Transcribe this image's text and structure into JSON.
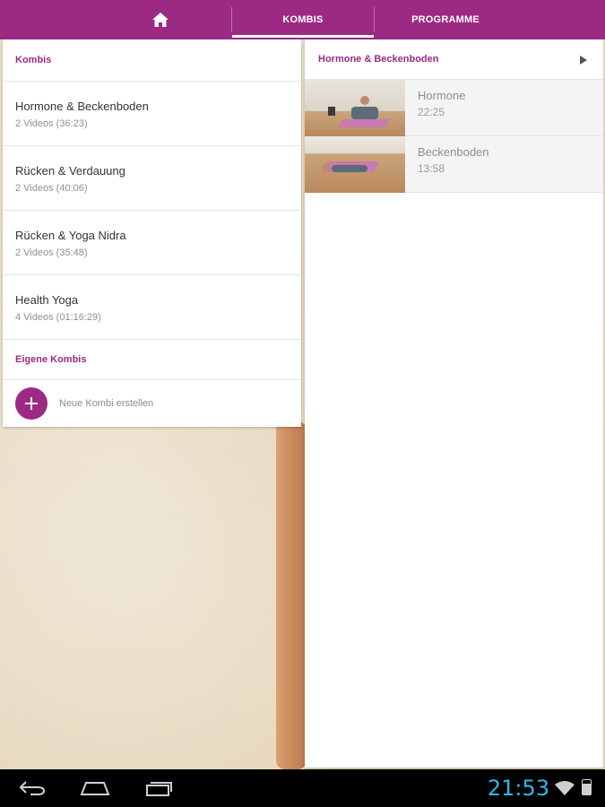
{
  "topbar": {
    "tabs": [
      {
        "label": "",
        "icon": "home-icon"
      },
      {
        "label": "KOMBIS",
        "selected": true
      },
      {
        "label": "PROGRAMME"
      }
    ]
  },
  "left": {
    "header": "Kombis",
    "items": [
      {
        "title": "Hormone & Beckenboden",
        "sub": "2 Videos (36:23)"
      },
      {
        "title": "Rücken & Verdauung",
        "sub": "2 Videos (40:06)"
      },
      {
        "title": "Rücken & Yoga Nidra",
        "sub": "2 Videos (35:48)"
      },
      {
        "title": "Health Yoga",
        "sub": "4 Videos (01:16:29)"
      }
    ],
    "own_header": "Eigene Kombis",
    "new_label": "Neue Kombi erstellen"
  },
  "right": {
    "header": "Hormone & Beckenboden",
    "videos": [
      {
        "title": "Hormone",
        "time": "22:25"
      },
      {
        "title": "Beckenboden",
        "time": "13:58"
      }
    ]
  },
  "sysbar": {
    "time": "21:53"
  },
  "colors": {
    "accent": "#9c2a84",
    "clock": "#33b5e5"
  }
}
